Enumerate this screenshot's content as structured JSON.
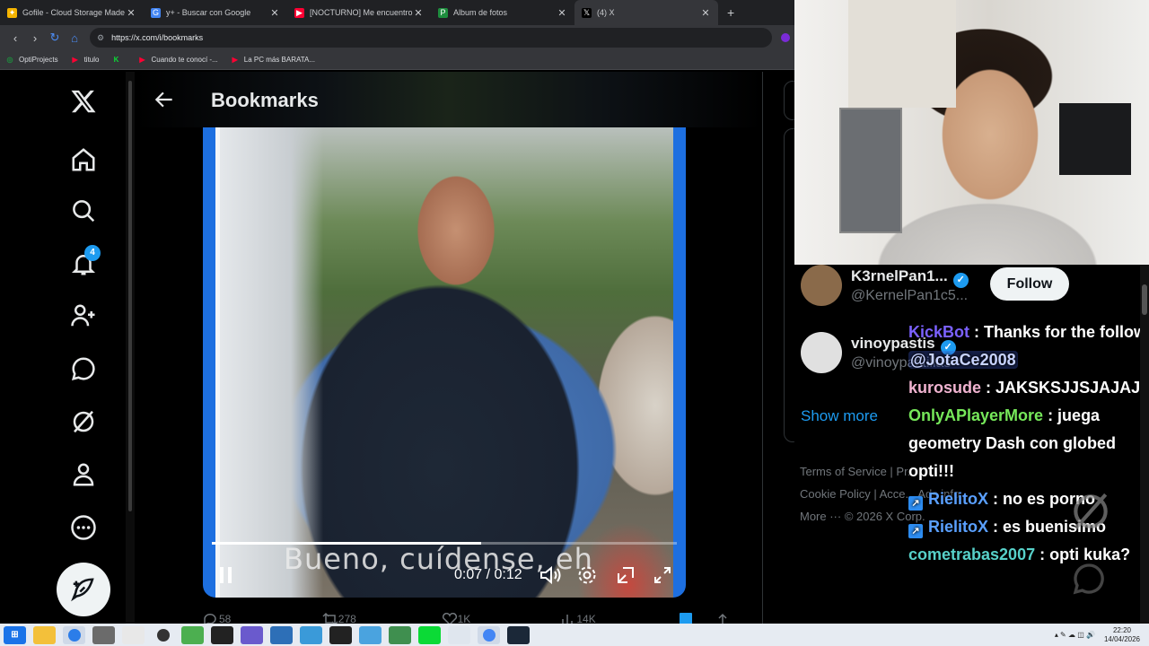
{
  "browser": {
    "tabs": [
      {
        "title": "Gofile - Cloud Storage Made Si",
        "favicon_color": "#f5b400",
        "glyph": "✦"
      },
      {
        "title": "y+ - Buscar con Google",
        "favicon_color": "#4285f4",
        "glyph": "G"
      },
      {
        "title": "[NOCTURNO] Me encuentro co",
        "favicon_color": "#ff0033",
        "glyph": "▶"
      },
      {
        "title": "Album de fotos",
        "favicon_color": "#1e8e3e",
        "glyph": "P"
      },
      {
        "title": "(4) X",
        "favicon_color": "#000000",
        "glyph": "𝕏"
      }
    ],
    "close_glyph": "✕",
    "new_tab_glyph": "+",
    "url": "https://x.com/i/bookmarks",
    "bookmarks": [
      {
        "label": "OptiProjects",
        "color": "#1e8e3e",
        "glyph": "◎"
      },
      {
        "label": "titulo",
        "color": "#ff0033",
        "glyph": "▶"
      },
      {
        "label": "",
        "color": "#0bda36",
        "glyph": "K"
      },
      {
        "label": "Cuando te conocí -...",
        "color": "#ff0033",
        "glyph": "▶"
      },
      {
        "label": "La PC más BARATA...",
        "color": "#ff0033",
        "glyph": "▶"
      }
    ]
  },
  "sidebar": {
    "notifications_badge": "4",
    "items": [
      "x-logo",
      "home",
      "explore",
      "notifications",
      "follow",
      "messages",
      "grok",
      "profile",
      "more"
    ]
  },
  "main": {
    "title": "Bookmarks",
    "video": {
      "subtitle": "Bueno, cuídense, eh",
      "time": "0:07 / 0:12",
      "progress": 0.58
    },
    "actions": {
      "replies": "58",
      "reposts": "278",
      "likes": "1K",
      "views": "14K"
    }
  },
  "who_to_follow": [
    {
      "name": "K3rnelPan1...",
      "handle": "@KernelPan1c5...",
      "verified": true,
      "avatar_color": "#8a6a4a"
    },
    {
      "name": "vinoypastis",
      "handle": "@vinoypastillas",
      "verified": true,
      "avatar_color": "#e0e0e0"
    }
  ],
  "follow_label": "Follow",
  "show_more": "Show more",
  "footer": {
    "line1": "Terms of Service  |  Pr...",
    "line2": "Cookie Policy  |  Acce...   Ads info",
    "line3": "More ···   © 2026 X Corp."
  },
  "chat": [
    {
      "user": "KickBot",
      "text": " : Thanks for the follow ",
      "mention": "@JotaCe2008",
      "cls": "u1"
    },
    {
      "user": "kurosude",
      "text": " : JAKSKSJJSJAJAJ",
      "cls": "u2"
    },
    {
      "user": "OnlyAPlayerMore",
      "text": " : juega geometry Dash con globed opti!!!",
      "cls": "u3"
    },
    {
      "user": "RielitoX",
      "text": " : no es porno",
      "cls": "u4",
      "badge": true
    },
    {
      "user": "RielitoX",
      "text": " : es buenisimo",
      "cls": "u4",
      "badge": true
    },
    {
      "user": "cometrabas2007",
      "text": " : opti kuka?",
      "cls": "u5"
    }
  ],
  "taskbar": {
    "time": "22:20",
    "date": "14/04/2026"
  }
}
